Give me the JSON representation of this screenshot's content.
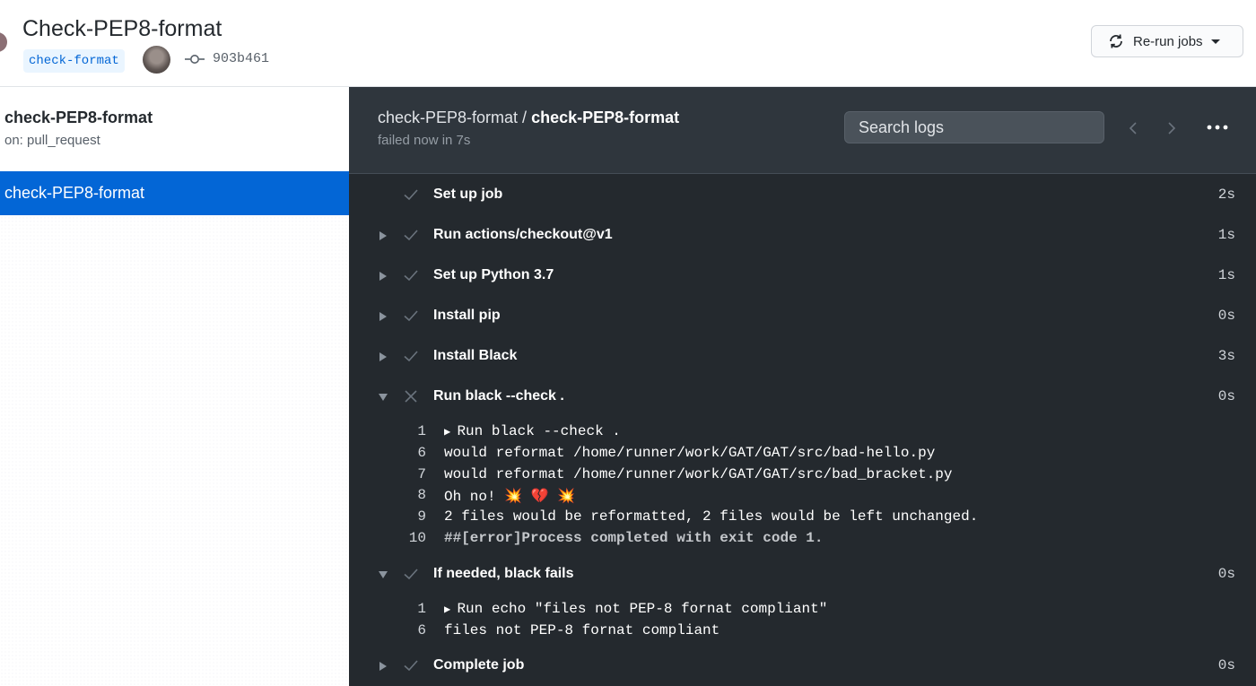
{
  "header": {
    "title": "Check-PEP8-format",
    "branch": "check-format",
    "commit_sha": "903b461",
    "rerun_label": "Re-run jobs"
  },
  "sidebar": {
    "workflow_name": "check-PEP8-format",
    "workflow_trigger": "on: pull_request",
    "jobs": [
      {
        "label": "check-PEP8-format",
        "selected": true
      }
    ]
  },
  "main": {
    "breadcrumb_workflow": "check-PEP8-format /",
    "breadcrumb_job": "check-PEP8-format",
    "status": "failed now in 7s",
    "search_placeholder": "Search logs",
    "steps": [
      {
        "name": "Set up job",
        "duration": "2s",
        "status": "success"
      },
      {
        "name": "Run actions/checkout@v1",
        "duration": "1s",
        "status": "success"
      },
      {
        "name": "Set up Python 3.7",
        "duration": "1s",
        "status": "success"
      },
      {
        "name": "Install pip",
        "duration": "0s",
        "status": "success"
      },
      {
        "name": "Install Black",
        "duration": "3s",
        "status": "success"
      },
      {
        "name": "Run black --check .",
        "duration": "0s",
        "status": "failure"
      },
      {
        "name": "If needed, black fails",
        "duration": "0s",
        "status": "success"
      },
      {
        "name": "Complete job",
        "duration": "0s",
        "status": "success"
      }
    ],
    "logs_black": [
      {
        "n": "1",
        "text": "Run black --check ."
      },
      {
        "n": "6",
        "text": "would reformat /home/runner/work/GAT/GAT/src/bad-hello.py"
      },
      {
        "n": "7",
        "text": "would reformat /home/runner/work/GAT/GAT/src/bad_bracket.py"
      },
      {
        "n": "8",
        "text": "Oh no! 💥 💔 💥"
      },
      {
        "n": "9",
        "text": "2 files would be reformatted, 2 files would be left unchanged."
      },
      {
        "n": "10",
        "text": "##[error]Process completed with exit code 1."
      }
    ],
    "logs_fails": [
      {
        "n": "1",
        "text": "Run echo \"files not PEP-8 fornat compliant\""
      },
      {
        "n": "6",
        "text": "files not PEP-8 fornat compliant"
      }
    ]
  },
  "colors": {
    "accent_blue": "#0366d6",
    "dark_bg": "#24292e",
    "dark_header": "#2f363d"
  }
}
